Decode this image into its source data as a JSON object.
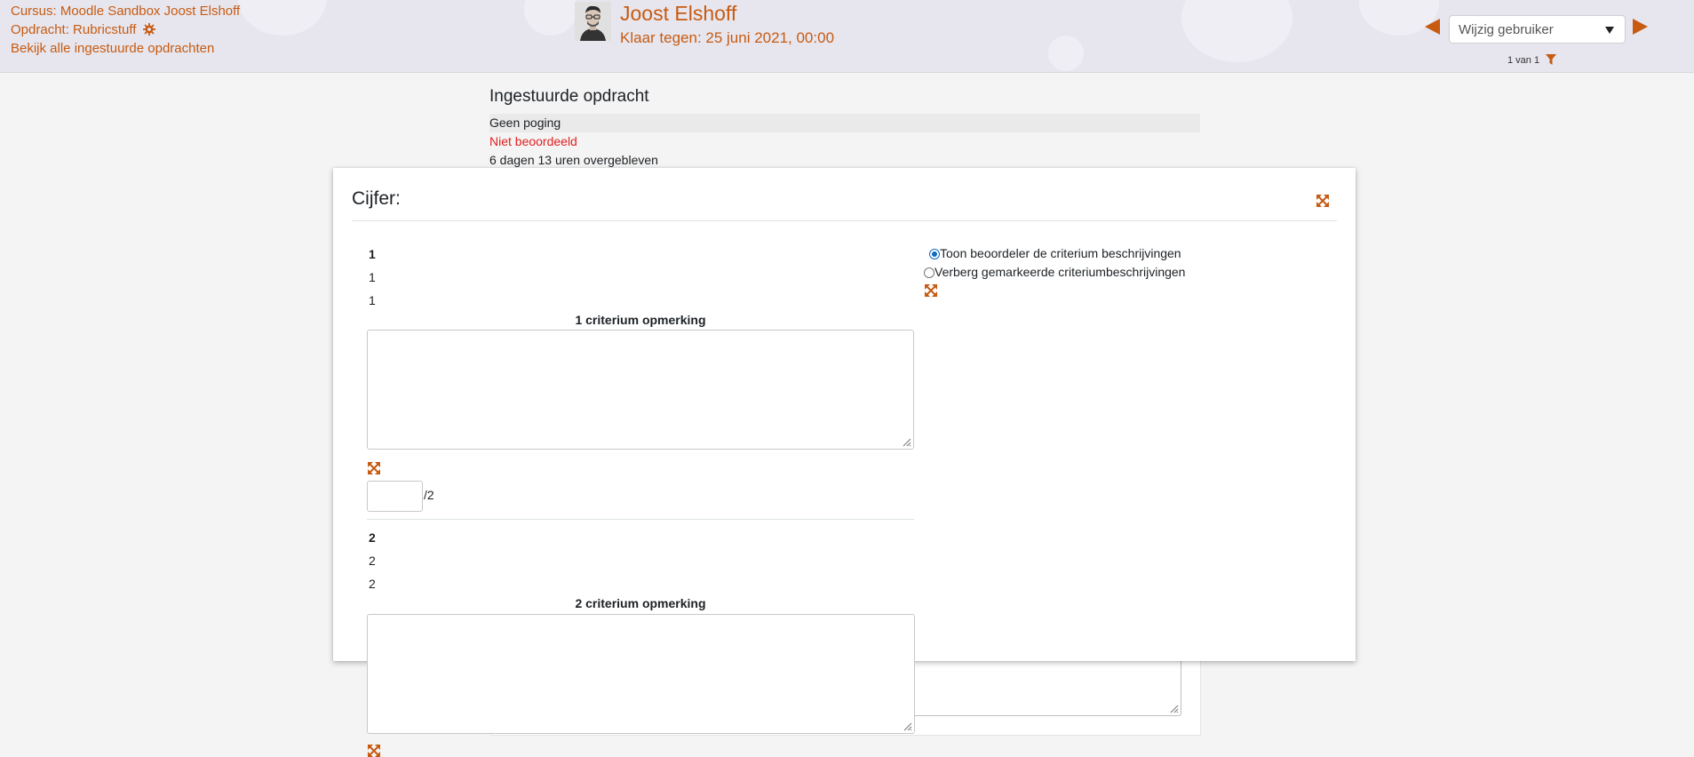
{
  "header": {
    "course_link": "Cursus: Moodle Sandbox Joost Elshoff",
    "assignment_link": "Opdracht: Rubricstuff",
    "view_all_link": "Bekijk alle ingestuurde opdrachten",
    "user_name": "Joost Elshoff",
    "due_date": "Klaar tegen: 25 juni 2021, 00:00",
    "user_select_placeholder": "Wijzig gebruiker",
    "count": "1 van 1"
  },
  "submission": {
    "title": "Ingestuurde opdracht",
    "attempt_status": "Geen poging",
    "grading_status": "Niet beoordeeld",
    "time_remaining": "6 dagen 13 uren overgebleven"
  },
  "grade_modal": {
    "title": "Cijfer:",
    "criteria": [
      {
        "name": "1",
        "description": "1",
        "level": "1",
        "remark_label": "1 criterium opmerking",
        "score_max": "/2"
      },
      {
        "name": "2",
        "description": "2",
        "level": "2",
        "remark_label": "2 criterium opmerking"
      }
    ],
    "options": [
      {
        "label": "Toon beoordeler de criterium beschrijvingen",
        "checked": true
      },
      {
        "label": "Verberg gemarkeerde criteriumbeschrijvingen",
        "checked": false
      }
    ]
  },
  "colors": {
    "accent": "#c75b12",
    "warning": "#e12121",
    "radio_selected": "#0f6cbf"
  },
  "icons": [
    "gear-icon",
    "filter-icon",
    "expand-icon",
    "prev-arrow-icon",
    "next-arrow-icon"
  ]
}
